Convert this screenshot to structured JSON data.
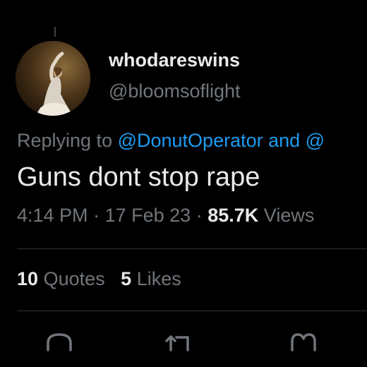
{
  "tweet": {
    "display_name": "whodareswins",
    "handle": "@bloomsoflight",
    "replying_prefix": "Replying to ",
    "replying_mention": "@DonutOperator",
    "replying_and": " and ",
    "replying_trailing": "@",
    "text": "Guns dont stop rape",
    "time": "4:14 PM",
    "separator": "·",
    "date": "17 Feb 23",
    "views_count": "85.7K",
    "views_label": "Views"
  },
  "stats": {
    "quotes_count": "10",
    "quotes_label": "Quotes",
    "likes_count": "5",
    "likes_label": "Likes"
  },
  "actions": {
    "reply_icon": "reply-icon",
    "retweet_icon": "retweet-icon",
    "like_icon": "heart-icon"
  },
  "colors": {
    "background": "#000000",
    "primary_text": "#e7e9ea",
    "secondary_text": "#71767b",
    "link": "#1d9bf0",
    "divider": "#2f3336"
  }
}
